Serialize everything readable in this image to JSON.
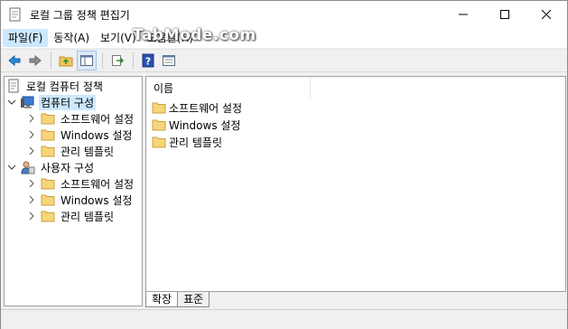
{
  "window": {
    "title": "로컬 그룹 정책 편집기"
  },
  "menu": [
    {
      "label": "파일(F)"
    },
    {
      "label": "동작(A)"
    },
    {
      "label": "보기(V)"
    },
    {
      "label": "도움말(H)"
    }
  ],
  "watermark": "TabMode.com",
  "toolbar": {
    "buttons": [
      "back-icon",
      "forward-icon",
      "up-folder-icon",
      "show-hide-tree-icon",
      "export-list-icon",
      "help-icon",
      "properties-icon"
    ]
  },
  "tree": {
    "root": "로컬 컴퓨터 정책",
    "computer": "컴퓨터 구성",
    "computer_children": [
      "소프트웨어 설정",
      "Windows 설정",
      "관리 템플릿"
    ],
    "user": "사용자 구성",
    "user_children": [
      "소프트웨어 설정",
      "Windows 설정",
      "관리 템플릿"
    ]
  },
  "list": {
    "column_header": "이름",
    "items": [
      "소프트웨어 설정",
      "Windows 설정",
      "관리 템플릿"
    ]
  },
  "tabs": [
    {
      "label": "확장"
    },
    {
      "label": "표준"
    }
  ],
  "colors": {
    "selection": "#cce8ff",
    "folder": "#f2c55c",
    "accent": "#2a6ebd"
  }
}
